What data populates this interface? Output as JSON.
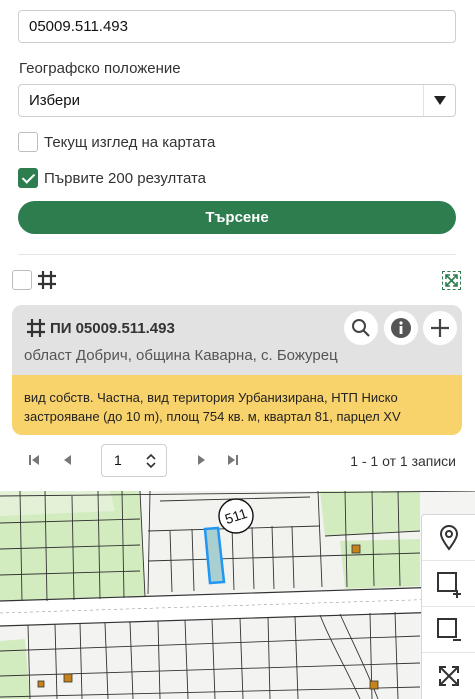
{
  "search": {
    "parcel_value": "05009.511.493"
  },
  "location": {
    "label": "Географско положение",
    "select_value": "Избери"
  },
  "options": {
    "current_view_label": "Текущ изглед на картата",
    "current_view_checked": false,
    "first_200_label": "Първите 200 резултата",
    "first_200_checked": true
  },
  "search_button_label": "Търсене",
  "result": {
    "title_prefix": "ПИ",
    "title_id": "05009.511.493",
    "subtitle": "област Добрич, община Каварна, с. Божурец",
    "details": "вид собств. Частна, вид територия Урбанизирана, НТП Ниско застрояване (до 10 m), площ 754 кв. м, квартал 81, парцел XV"
  },
  "pager": {
    "page": "1",
    "summary": "1 - 1 от 1 записи"
  },
  "map": {
    "block_label": "511"
  },
  "colors": {
    "accent": "#2e7d4f",
    "highlight": "#f8d36c",
    "card": "#e2e2e2",
    "parcel": "#2196f3"
  },
  "icons": [
    "grid-icon",
    "expand-icon",
    "search-icon",
    "info-icon",
    "plus-icon",
    "first-page-icon",
    "prev-page-icon",
    "next-page-icon",
    "last-page-icon",
    "location-pin-icon",
    "zoom-select-in-icon",
    "zoom-select-out-icon",
    "fullscreen-icon"
  ]
}
